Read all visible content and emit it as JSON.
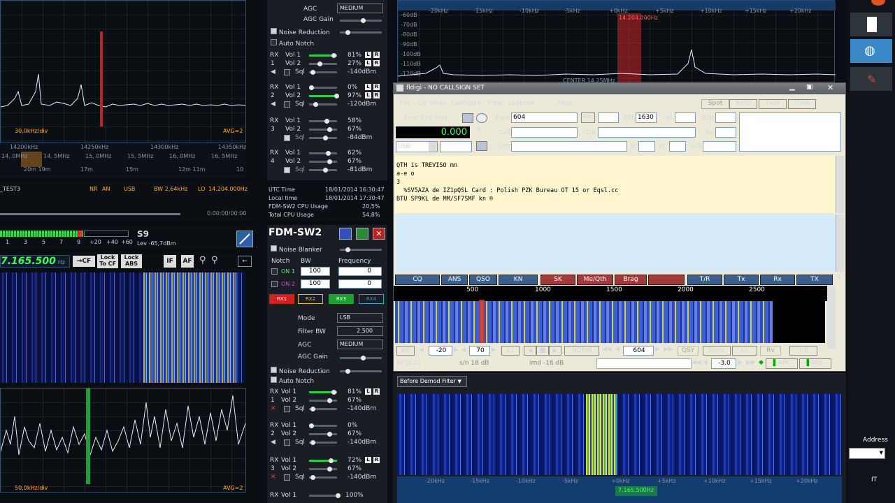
{
  "spectrum_top_left": {
    "div": "30,0kHz/div",
    "avg": "AVG=2",
    "freqs": [
      "14200kHz",
      "14250kHz",
      "14300kHz",
      "14350kHz"
    ],
    "bands": [
      "14, 0MHz",
      "14, 5MHz",
      "15, 0MHz",
      "15, 5MHz",
      "16, 0MHz",
      "16, 5MHz"
    ],
    "meters": [
      "20m 19m",
      "17m",
      "15m",
      "12m 11m",
      "10"
    ]
  },
  "status_bar_left": {
    "name": "_TEST3",
    "nr": "NR",
    "an": "AN",
    "mode": "USB",
    "bw": "BW 2,64kHz",
    "lo": "LO",
    "lo_freq": "14.204.000Hz",
    "time": "0.00:00/00:00"
  },
  "smeter": {
    "value": "S9",
    "lev": "Lev -65,7dBm",
    "scale": [
      "1",
      "3",
      "5",
      "7",
      "9",
      "+20",
      "+40",
      "+60"
    ]
  },
  "rx2": {
    "freq": "7.165.500",
    "unit": "Hz",
    "cf": "CF",
    "lock_cf": "Lock To CF",
    "lock_abs": "Lock ABS",
    "if": "IF",
    "af": "AF",
    "div": "50,0kHz/div",
    "avg": "AVG=2"
  },
  "agc_top": {
    "agc_label": "AGC",
    "agc_value": "MEDIUM",
    "agc_gain": "AGC Gain",
    "noise_reduction": "Noise Reduction",
    "auto_notch": "Auto Notch"
  },
  "rx_rows_top": [
    {
      "rx": "RX",
      "n": "1",
      "v1": "Vol 1",
      "p1": "81%",
      "v2": "Vol 2",
      "p2": "27%",
      "sql": "Sql",
      "db": "-140dBm"
    },
    {
      "rx": "RX",
      "n": "2",
      "v1": "Vol 1",
      "p1": "0%",
      "v2": "Vol 2",
      "p2": "97%",
      "sql": "Sql",
      "db": "-120dBm"
    },
    {
      "rx": "RX",
      "n": "3",
      "v1": "Vol 1",
      "p1": "58%",
      "v2": "Vol 2",
      "p2": "67%",
      "sql": "Sql",
      "db": "-84dBm"
    },
    {
      "rx": "RX",
      "n": "4",
      "v1": "Vol 1",
      "p1": "62%",
      "v2": "Vol 2",
      "p2": "67%",
      "sql": "Sql",
      "db": "-81dBm"
    }
  ],
  "times": {
    "utc_label": "UTC Time",
    "utc": "18/01/2014 16:30:47",
    "local_label": "Local time",
    "local": "18/01/2014 17:30:47",
    "cpu_label": "FDM-SW2 CPU Usage",
    "cpu": "20,5%",
    "total_label": "Total CPU Usage",
    "total": "54,8%"
  },
  "fdm": {
    "title": "FDM-SW2",
    "noise_blanker": "Noise Blanker",
    "notch": "Notch",
    "bw": "BW",
    "frequency": "Frequency",
    "on1": "ON 1",
    "on2": "ON 2",
    "bw1": "100",
    "bw2": "100",
    "f1": "0",
    "f2": "0",
    "rx_buttons": [
      "RX1",
      "RX2",
      "RX3",
      "RX4"
    ],
    "mode_label": "Mode",
    "mode": "LSB",
    "filter_label": "Filter BW",
    "filter": "2.500",
    "agc_label": "AGC",
    "agc": "MEDIUM",
    "agc_gain": "AGC Gain",
    "noise_reduction": "Noise Reduction",
    "auto_notch": "Auto Notch"
  },
  "rx_rows_bottom": [
    {
      "rx": "RX",
      "n": "1",
      "v1": "Vol 1",
      "p1": "81%",
      "v2": "Vol 2",
      "p2": "67%",
      "sql": "Sql",
      "db": "-140dBm"
    },
    {
      "rx": "RX",
      "n": "2",
      "v1": "Vol 1",
      "p1": "0%",
      "v2": "Vol 2",
      "p2": "67%",
      "sql": "Sql",
      "db": "-140dBm"
    },
    {
      "rx": "RX",
      "n": "3",
      "v1": "Vol 1",
      "p1": "72%",
      "v2": "Vol 2",
      "p2": "67%",
      "sql": "Sql",
      "db": "-140dBm"
    },
    {
      "rx": "RX",
      "n": "4",
      "v1": "Vol 1",
      "p1": "100%"
    }
  ],
  "top_spectrum_right": {
    "freqs": [
      "-20kHz",
      "-15kHz",
      "-10kHz",
      "-5kHz",
      "+0kHz",
      "+5kHz",
      "+10kHz",
      "+15kHz",
      "+20kHz"
    ],
    "db": [
      "-60dB",
      "-70dB",
      "-80dB",
      "-90dB",
      "-100dB",
      "-110dB",
      "-120dB"
    ],
    "marker": "14.204.000Hz",
    "center": "CENTER 14.25MHz"
  },
  "fldigi": {
    "title": "fldigi - NO CALLSIGN SET",
    "menu": [
      "File",
      "Op Mode",
      "Configure",
      "View",
      "Logbook",
      "Help"
    ],
    "spot": "Spot",
    "rxid": "RxID",
    "txid": "TxID",
    "tune": "TUNE",
    "enter_xcvr": "Enter Xcvr Freq",
    "freq_label": "Freq",
    "freq": "604",
    "on_label": "On",
    "off_label": "Off",
    "off": "1630",
    "in_label": "In",
    "out_label": "Out",
    "call_label": "Call",
    "op_label": "Op",
    "az_label": "Az",
    "qth_label": "Qth",
    "st_label": "St",
    "pr_label": "Pr",
    "loc_label": "Loc",
    "display_freq": "0.000",
    "mode": "USB",
    "rx_text": [
      "QTH is TREVISO mn",
      "a-e o",
      "3",
      "  %SV5AZA de IZ1pQSL Card : Polish PZK Bureau OT 15 or Eqsl.cc",
      "BTU SP9KL de MM/SF7SMF kn ®"
    ],
    "macros": [
      "CQ",
      "ANS",
      "QSO",
      "KN",
      "SK",
      "Me/Qth",
      "Brag",
      "",
      "T/R",
      "Tx",
      "Rx",
      "TX"
    ],
    "macro_page": "1",
    "scale": [
      "500",
      "1000",
      "1500",
      "2000",
      "2500"
    ],
    "ctrl": {
      "wf": "WF",
      "lvl": "-20",
      "rng": "70",
      "x1": "x1",
      "norm": "NORM",
      "freq": "604",
      "qsy": "QSY",
      "store": "Store",
      "lk": "Lk",
      "rv": "Rv",
      "tr": "T/R"
    },
    "status": {
      "mode": "BPSK31",
      "sn": "s/n 18 dB",
      "imd": "imd -16 dB",
      "val": "-3.0",
      "afc": "AFC",
      "sql": "SQL"
    }
  },
  "demod": {
    "filter": "Before Demod Filter",
    "marker": "7.165.500Hz",
    "freqs": [
      "-20kHz",
      "-15kHz",
      "-10kHz",
      "-5kHz",
      "+0kHz",
      "+5kHz",
      "+10kHz",
      "+15kHz",
      "+20kHz"
    ]
  },
  "right_panel": {
    "address": "Address",
    "lang": "IT"
  }
}
